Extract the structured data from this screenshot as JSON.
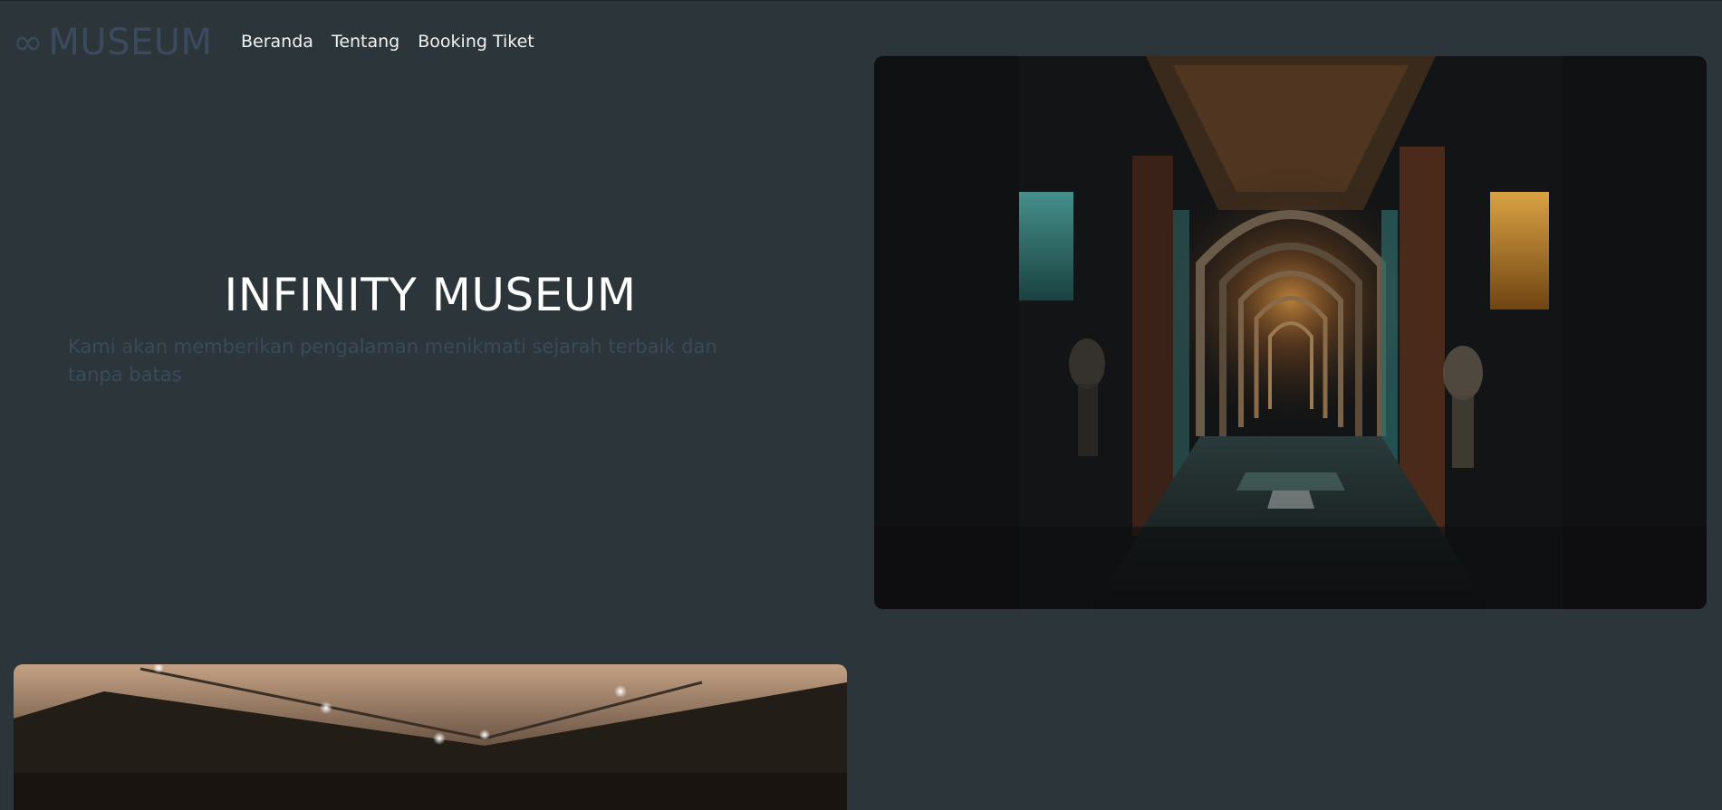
{
  "brand": {
    "icon": "∞",
    "icon_name": "infinity-icon",
    "name": "MUSEUM"
  },
  "nav": {
    "items": [
      {
        "label": "Beranda"
      },
      {
        "label": "Tentang"
      },
      {
        "label": "Booking Tiket"
      }
    ]
  },
  "hero": {
    "title": "INFINITY MUSEUM",
    "subtitle": "Kami akan memberikan pengalaman menikmati sejarah terbaik dan tanpa batas"
  },
  "images": {
    "hero_image_name": "museum-corridor-image",
    "gallery_image_name": "gallery-ceiling-image"
  },
  "colors": {
    "background": "#2c363a",
    "brand": "#3b4a5e",
    "nav_text": "#f2f2f2",
    "title": "#ffffff",
    "subtitle": "#3a4a5a"
  }
}
